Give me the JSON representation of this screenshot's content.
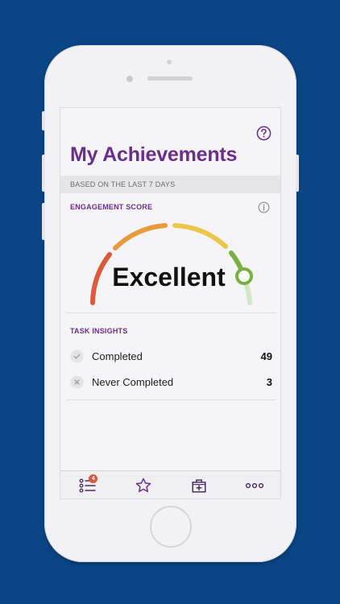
{
  "header": {
    "title": "My Achievements",
    "help_icon": "question-circle-icon"
  },
  "period_band": {
    "text": "BASED ON THE LAST 7 DAYS"
  },
  "engagement": {
    "label": "ENGAGEMENT SCORE",
    "info_icon": "info-circle-icon",
    "score_text": "Excellent",
    "gauge_level": 0.95,
    "segment_colors": [
      "#e0573a",
      "#e89a3c",
      "#e9c74a",
      "#79b041"
    ]
  },
  "insights": {
    "label": "TASK INSIGHTS",
    "rows": [
      {
        "icon": "check-icon",
        "label": "Completed",
        "value": "49"
      },
      {
        "icon": "x-icon",
        "label": "Never Completed",
        "value": "3"
      }
    ]
  },
  "tabbar": {
    "tabs": [
      {
        "name": "tasks",
        "icon": "list-icon",
        "badge": "4"
      },
      {
        "name": "achievements",
        "icon": "star-icon"
      },
      {
        "name": "medical",
        "icon": "medical-kit-icon"
      },
      {
        "name": "more",
        "icon": "more-dots-icon"
      }
    ]
  },
  "colors": {
    "brand_purple": "#6b2d8e",
    "background_blue": "#0a4586",
    "badge": "#e0573a"
  }
}
